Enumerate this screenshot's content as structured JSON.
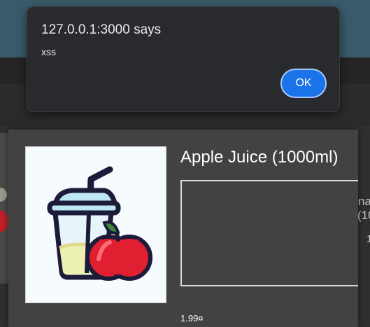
{
  "alert": {
    "origin": "127.0.0.1:3000 says",
    "message": "xss",
    "ok_label": "OK"
  },
  "product": {
    "title": "Apple Juice (1000ml)",
    "price": "1.99¤",
    "image_icon": "apple-juice-icon"
  },
  "background_card": {
    "line1": "na",
    "line2": "(10",
    "line3": "1"
  },
  "colors": {
    "toolbar": "#3a5b6b",
    "dialog": "#424242",
    "alert_bg": "#292a2d",
    "ok_button": "#1a73e8"
  }
}
